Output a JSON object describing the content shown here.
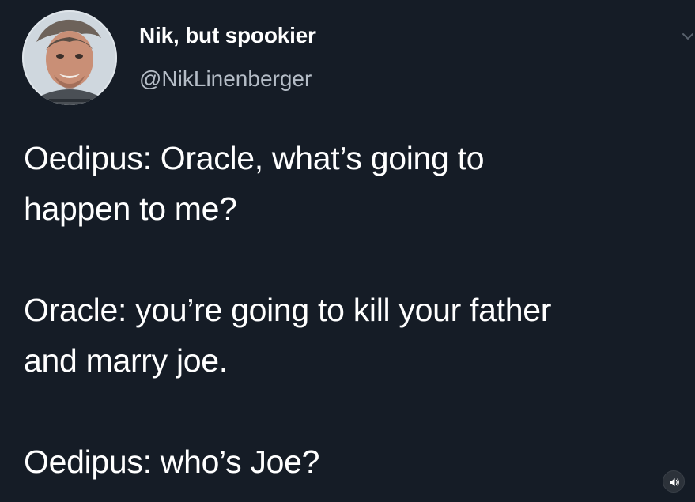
{
  "tweet": {
    "author": {
      "display_name": "Nik, but spookier",
      "handle": "@NikLinenberger",
      "avatar_icon": "profile-photo"
    },
    "menu_icon": "chevron-down-icon",
    "lines": [
      "Oedipus: Oracle, what’s going to",
      "happen to me?",
      "",
      "Oracle: you’re going to kill your father",
      "and marry joe.",
      "",
      "Oedipus: who’s Joe?"
    ]
  },
  "controls": {
    "volume_icon": "speaker-icon"
  },
  "colors": {
    "background": "#151c26",
    "text": "#ffffff",
    "handle": "#b4bcc6"
  }
}
